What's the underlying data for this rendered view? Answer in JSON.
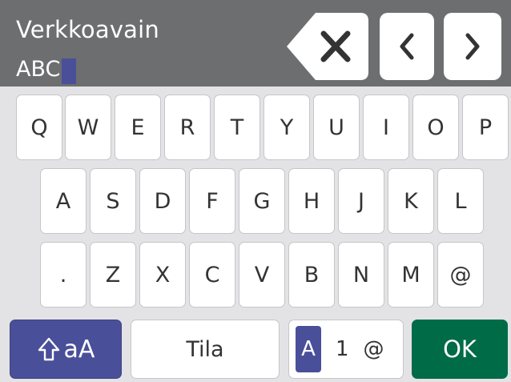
{
  "header": {
    "title": "Verkkoavain",
    "entry_value": "ABC"
  },
  "controls": {
    "backspace_icon": "backspace-x-icon",
    "prev_icon": "chevron-left-icon",
    "next_icon": "chevron-right-icon"
  },
  "keyboard": {
    "row1": [
      "Q",
      "W",
      "E",
      "R",
      "T",
      "Y",
      "U",
      "I",
      "O",
      "P"
    ],
    "row2": [
      "A",
      "S",
      "D",
      "F",
      "G",
      "H",
      "J",
      "K",
      "L"
    ],
    "row3": [
      ".",
      "Z",
      "X",
      "C",
      "V",
      "B",
      "N",
      "M",
      "@"
    ],
    "shift_label": "aA",
    "shift_icon": "shift-arrow-icon",
    "space_label": "Tila",
    "mode_letter": "A",
    "mode_digit": "1",
    "mode_symbol": "@",
    "ok_label": "OK"
  },
  "colors": {
    "header_bg": "#6c6e70",
    "accent": "#4a4f9a",
    "ok_bg": "#006b47",
    "keyboard_bg": "#e3e3e5"
  }
}
